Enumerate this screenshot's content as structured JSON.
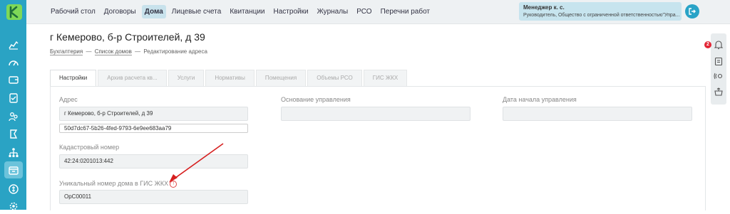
{
  "nav": {
    "items": [
      "Рабочий стол",
      "Договоры",
      "Дома",
      "Лицевые счета",
      "Квитанции",
      "Настройки",
      "Журналы",
      "РСО",
      "Перечни работ"
    ],
    "active": "Дома"
  },
  "user": {
    "name": "Менеджер к. с.",
    "role": "Руководитель, Общество с ограниченной ответственностью\"Упра..."
  },
  "notifications": {
    "count": "2"
  },
  "page": {
    "title": "г Кемерово, б-р Строителей, д 39",
    "breadcrumb": [
      "Бухгалтерия",
      "Список домов",
      "Редактирование адреса"
    ]
  },
  "tabs": [
    "Настройки",
    "Архив расчета кв...",
    "Услуги",
    "Нормативы",
    "Помещения",
    "Объемы РСО",
    "ГИС ЖКХ"
  ],
  "form": {
    "address_label": "Адрес",
    "address_value": "г Кемерово, б-р Строителей, д 39",
    "address_guid": "50d7dc67-5b26-4fed-9793-6e9ee683aa79",
    "cadastral_label": "Кадастровый номер",
    "cadastral_value": "42:24:0201013:442",
    "gis_label": "Уникальный номер дома в ГИС ЖКХ",
    "gis_value": "OpC00011",
    "basis_label": "Основание управления",
    "basis_value": "",
    "start_date_label": "Дата начала управления",
    "start_date_value": ""
  },
  "colors": {
    "sidebar": "#2aa3c4",
    "logo": "#7ed957",
    "topbar": "#eef1f3",
    "accent": "#c8e2ec",
    "badge": "#e32636",
    "arrow": "#d62020"
  },
  "icons": {
    "sidebar": [
      "logo-icon",
      "chart-icon",
      "gauge-icon",
      "wallet-icon",
      "checklist-icon",
      "people-icon",
      "flag-icon",
      "hierarchy-icon",
      "box-icon",
      "coin-icon",
      "settings-icon"
    ],
    "rail": [
      "bell-icon",
      "clipboard-icon",
      "sound-icon",
      "basket-icon"
    ]
  }
}
